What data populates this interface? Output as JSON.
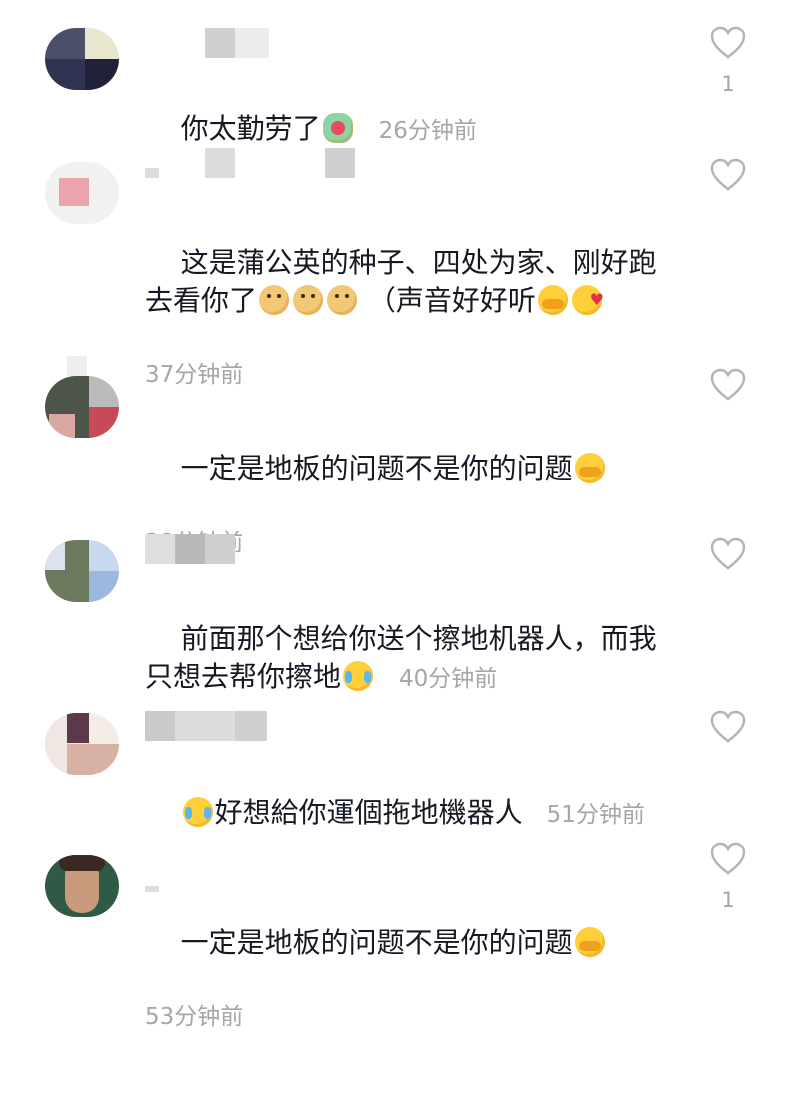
{
  "comments": [
    {
      "text": "你太勤劳了",
      "time": "26分钟前",
      "likes": "1"
    },
    {
      "text_line1": "这是蒲公英的种子、四处为家、刚好跑",
      "text_line2": "去看你了",
      "text_tail": "（声音好好听",
      "time": "37分钟前",
      "likes": ""
    },
    {
      "text": "一定是地板的问题不是你的问题",
      "time": "38分钟前",
      "likes": ""
    },
    {
      "text_line1": "前面那个想给你送个擦地机器人，而我",
      "text_line2": "只想去帮你擦地",
      "time": "40分钟前",
      "likes": ""
    },
    {
      "text": "好想給你運個拖地機器人",
      "time": "51分钟前",
      "likes": ""
    },
    {
      "text": "一定是地板的问题不是你的问题",
      "time": "53分钟前",
      "likes": "1"
    }
  ],
  "icons": {
    "like": "heart-outline-icon",
    "emoji_cake": "cake-emoji-icon",
    "emoji_doge": "doge-emoji-icon",
    "emoji_grin_cover": "covering-mouth-emoji-icon",
    "emoji_kiss_heart": "blowing-kiss-emoji-icon",
    "emoji_laugh_cry": "laughing-crying-emoji-icon"
  },
  "colors": {
    "text": "#161823",
    "meta": "#a5a5aa",
    "background": "#ffffff"
  }
}
